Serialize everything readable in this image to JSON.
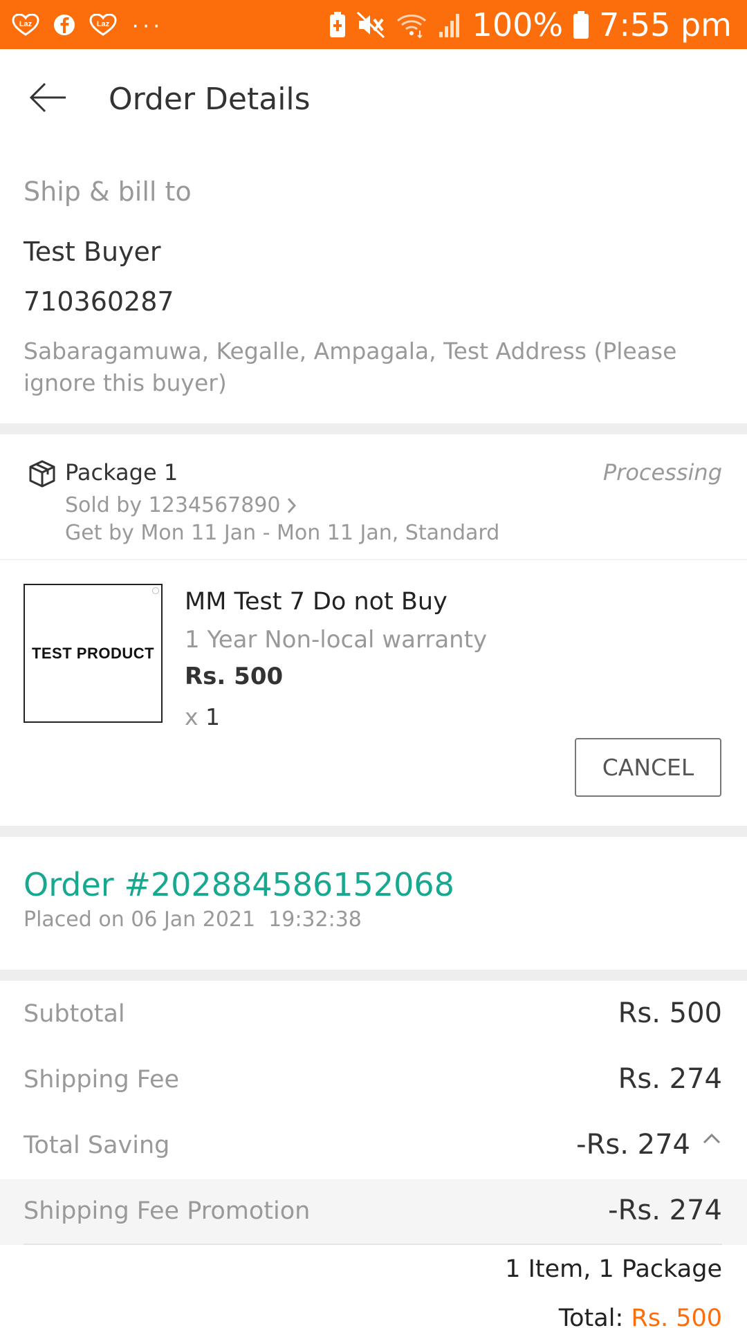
{
  "status_bar": {
    "apps": [
      "laz-icon",
      "facebook-icon",
      "laz-icon"
    ],
    "more": "···",
    "battery_percent": "100%",
    "time": "7:55 pm"
  },
  "header": {
    "title": "Order Details"
  },
  "ship_to": {
    "title": "Ship & bill to",
    "name": "Test Buyer",
    "phone": "710360287",
    "address": "Sabaragamuwa, Kegalle, Ampagala, Test Address (Please ignore this buyer)"
  },
  "package": {
    "label": "Package 1",
    "status": "Processing",
    "sold_by": "Sold by 1234567890",
    "delivery": "Get by Mon 11 Jan - Mon 11 Jan, Standard",
    "product": {
      "image_text": "TEST PRODUCT",
      "name": "MM Test 7 Do not Buy",
      "warranty": "1 Year Non-local warranty",
      "price": "Rs. 500",
      "qty_prefix": "x",
      "qty": "1"
    },
    "cancel_label": "CANCEL"
  },
  "order": {
    "number": "Order #202884586152068",
    "placed": "Placed on 06 Jan 2021  19:32:38"
  },
  "summary": {
    "rows": [
      {
        "label": "Subtotal",
        "value": "Rs. 500"
      },
      {
        "label": "Shipping Fee",
        "value": "Rs. 274"
      },
      {
        "label": "Total Saving",
        "value": "-Rs. 274"
      },
      {
        "label": "Shipping Fee Promotion",
        "value": "-Rs. 274"
      }
    ],
    "items_count": "1 Item, 1 Package",
    "total_label": "Total:",
    "total_value": "Rs. 500"
  },
  "colors": {
    "brand_orange": "#fc6e0b",
    "order_green": "#17a88f"
  }
}
